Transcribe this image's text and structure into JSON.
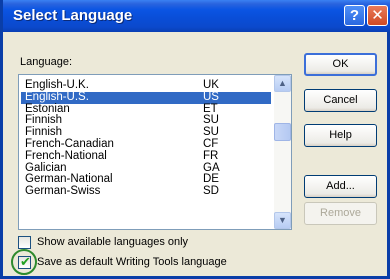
{
  "window": {
    "title": "Select Language",
    "help_glyph": "?",
    "close_glyph": "✕"
  },
  "language_label": "Language:",
  "languages": [
    {
      "name": "English-U.K.",
      "code": "UK",
      "selected": false
    },
    {
      "name": "English-U.S.",
      "code": "US",
      "selected": true
    },
    {
      "name": "Estonian",
      "code": "ET",
      "selected": false
    },
    {
      "name": "Finnish",
      "code": "SU",
      "selected": false
    },
    {
      "name": "Finnish",
      "code": "SU",
      "selected": false
    },
    {
      "name": "French-Canadian",
      "code": "CF",
      "selected": false
    },
    {
      "name": "French-National",
      "code": "FR",
      "selected": false
    },
    {
      "name": "Galician",
      "code": "GA",
      "selected": false
    },
    {
      "name": "German-National",
      "code": "DE",
      "selected": false
    },
    {
      "name": "German-Swiss",
      "code": "SD",
      "selected": false
    }
  ],
  "buttons": {
    "ok": "OK",
    "cancel": "Cancel",
    "help": "Help",
    "add": "Add...",
    "remove": "Remove"
  },
  "options": {
    "show_available": {
      "label": "Show available languages only",
      "checked": false
    },
    "save_default": {
      "label": "Save as default Writing Tools language",
      "checked": true
    }
  },
  "colors": {
    "title_bar": "#0a4ed8",
    "selection": "#316ac5",
    "check_mark": "#21a121",
    "highlight_ring": "#2e8b2e"
  },
  "icons": {
    "scroll_up": "▲",
    "scroll_down": "▼",
    "check": "✔"
  }
}
